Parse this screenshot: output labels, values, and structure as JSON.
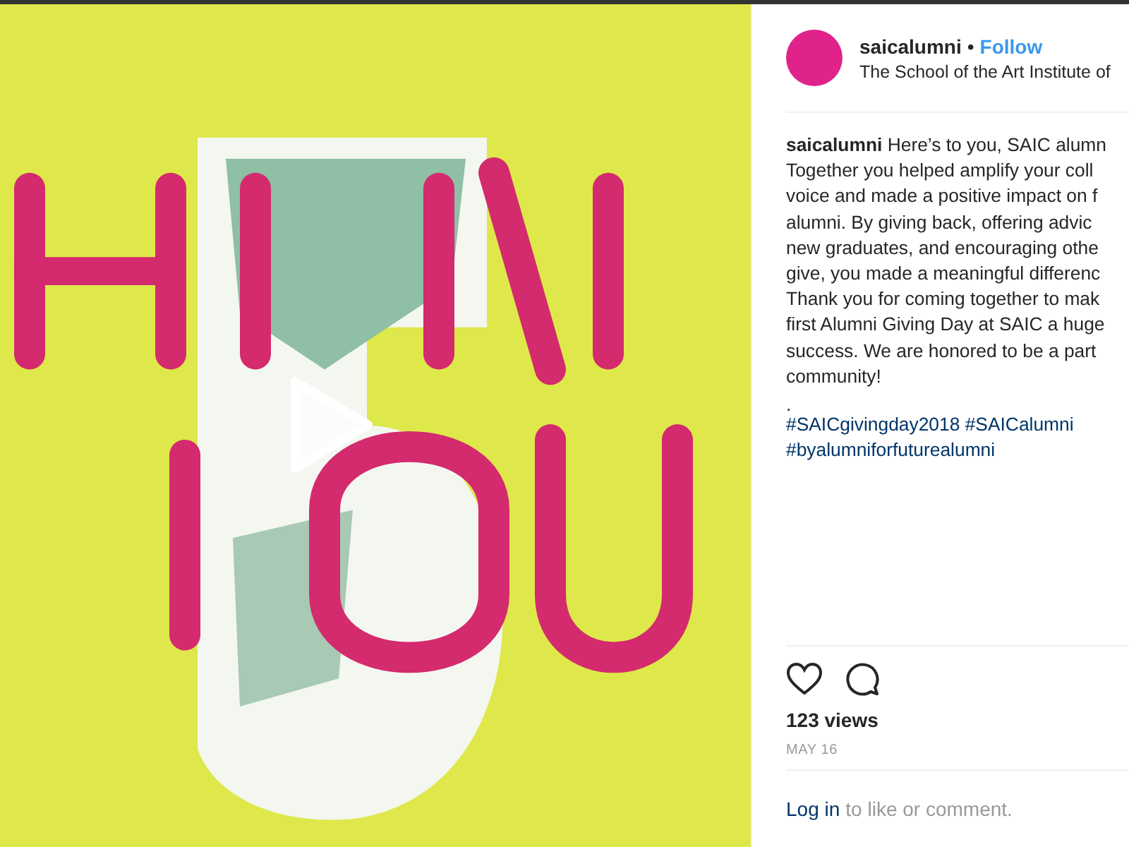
{
  "header": {
    "username": "saicalumni",
    "separator": "•",
    "follow": "Follow",
    "subtitle": "The School of the Art Institute of"
  },
  "caption": {
    "username": "saicalumni",
    "lines": [
      "Here’s to you, SAIC alumn",
      "Together you helped amplify your coll",
      "voice and made a positive impact on f",
      "alumni. By giving back, offering advic",
      "new graduates, and encouraging othe",
      "give, you made a meaningful differenc",
      "Thank you for coming together to mak",
      "first Alumni Giving Day at SAIC a huge",
      "success. We are honored to be a part",
      "community!"
    ],
    "dot": ".",
    "hashtag_lines": [
      "#SAICgivingday2018 #SAICalumni",
      "#byalumniforfuturealumni"
    ]
  },
  "stats": {
    "views": "123 views",
    "date": "MAY 16"
  },
  "login": {
    "link": "Log in",
    "text": "to like or comment."
  }
}
